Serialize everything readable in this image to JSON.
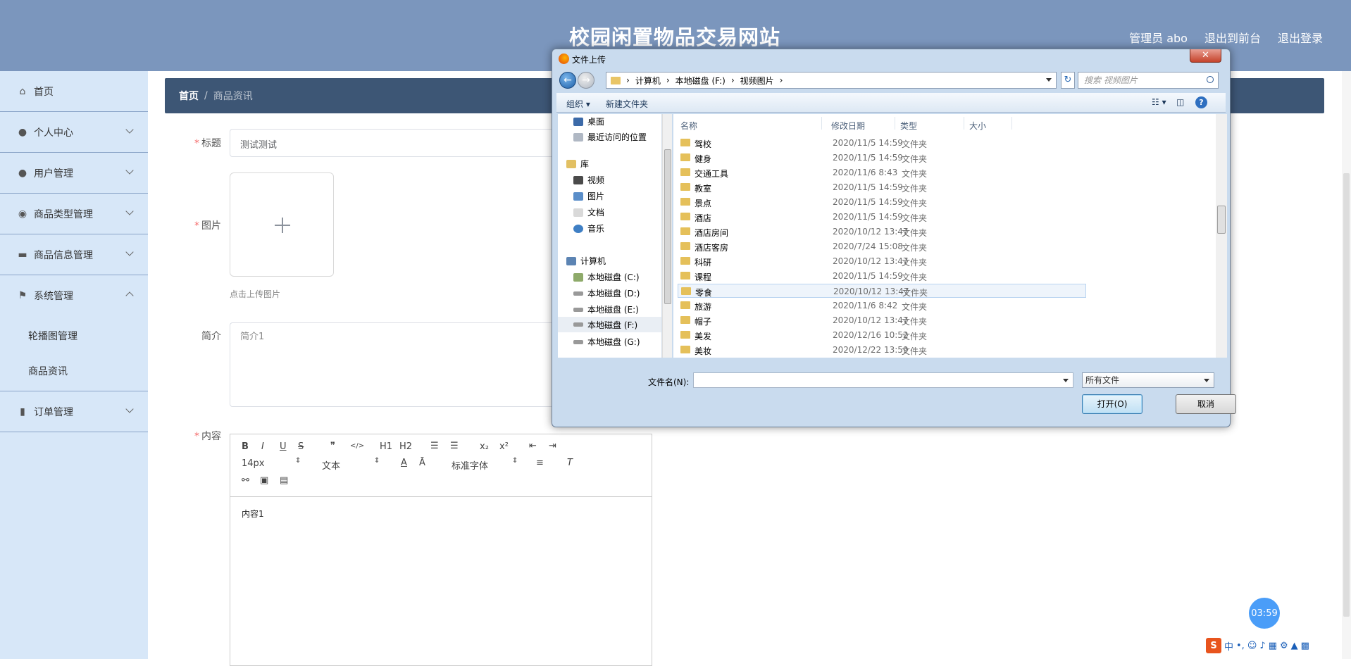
{
  "header": {
    "site_title": "校园闲置物品交易网站",
    "admin_label": "管理员 abo",
    "to_front_label": "退出到前台",
    "logout_label": "退出登录"
  },
  "sidebar": {
    "items": [
      {
        "label": "首页",
        "icon": "home-icon"
      },
      {
        "label": "个人中心",
        "icon": "user-icon"
      },
      {
        "label": "用户管理",
        "icon": "user-icon"
      },
      {
        "label": "商品类型管理",
        "icon": "location-icon"
      },
      {
        "label": "商品信息管理",
        "icon": "ticket-icon"
      },
      {
        "label": "系统管理",
        "icon": "flag-icon"
      },
      {
        "label": "订单管理",
        "icon": "chart-icon"
      }
    ],
    "sub_items": [
      "轮播图管理",
      "商品资讯"
    ]
  },
  "breadcrumb": {
    "home": "首页",
    "separator": "/",
    "current": "商品资讯"
  },
  "form": {
    "title_label": "标题",
    "title_value": "测试测试",
    "image_label": "图片",
    "image_hint": "点击上传图片",
    "intro_label": "简介",
    "intro_value": "简介1",
    "content_label": "内容",
    "content_value": "内容1"
  },
  "editor": {
    "font_size": "14px",
    "paragraph": "文本",
    "font_family": "标准字体",
    "tools_row1": [
      "B",
      "I",
      "U",
      "S",
      "❞",
      "</>",
      "H1",
      "H2",
      "ol",
      "ul",
      "x₂",
      "x²",
      "outdent",
      "indent"
    ]
  },
  "timer": "03:59",
  "dialog": {
    "title": "文件上传",
    "close_label": "✕",
    "path": [
      "计算机",
      "本地磁盘 (F:)",
      "视频图片"
    ],
    "search_placeholder": "搜索 视频图片",
    "organize": "组织 ▾",
    "new_folder": "新建文件夹",
    "help": "?",
    "nav": {
      "favorites": [
        "桌面",
        "最近访问的位置"
      ],
      "library_label": "库",
      "library": [
        "视频",
        "图片",
        "文档",
        "音乐"
      ],
      "computer_label": "计算机",
      "drives": [
        "本地磁盘 (C:)",
        "本地磁盘 (D:)",
        "本地磁盘 (E:)",
        "本地磁盘 (F:)",
        "本地磁盘 (G:)"
      ]
    },
    "columns": {
      "name": "名称",
      "date": "修改日期",
      "type": "类型",
      "size": "大小"
    },
    "files": [
      {
        "name": "驾校",
        "date": "2020/11/5 14:59",
        "type": "文件夹"
      },
      {
        "name": "健身",
        "date": "2020/11/5 14:59",
        "type": "文件夹"
      },
      {
        "name": "交通工具",
        "date": "2020/11/6 8:43",
        "type": "文件夹"
      },
      {
        "name": "教室",
        "date": "2020/11/5 14:59",
        "type": "文件夹"
      },
      {
        "name": "景点",
        "date": "2020/11/5 14:59",
        "type": "文件夹"
      },
      {
        "name": "酒店",
        "date": "2020/11/5 14:59",
        "type": "文件夹"
      },
      {
        "name": "酒店房间",
        "date": "2020/10/12 13:47",
        "type": "文件夹"
      },
      {
        "name": "酒店客房",
        "date": "2020/7/24 15:08",
        "type": "文件夹"
      },
      {
        "name": "科研",
        "date": "2020/10/12 13:47",
        "type": "文件夹"
      },
      {
        "name": "课程",
        "date": "2020/11/5 14:59",
        "type": "文件夹"
      },
      {
        "name": "零食",
        "date": "2020/10/12 13:47",
        "type": "文件夹"
      },
      {
        "name": "旅游",
        "date": "2020/11/6 8:42",
        "type": "文件夹"
      },
      {
        "name": "帽子",
        "date": "2020/10/12 13:47",
        "type": "文件夹"
      },
      {
        "name": "美发",
        "date": "2020/12/16 10:52",
        "type": "文件夹"
      },
      {
        "name": "美妆",
        "date": "2020/12/22 13:59",
        "type": "文件夹"
      }
    ],
    "filename_label": "文件名(N):",
    "filename_value": "",
    "filetype_value": "所有文件",
    "open_label": "打开(O)",
    "cancel_label": "取消"
  },
  "ime": {
    "logo": "S",
    "mode": "中"
  }
}
